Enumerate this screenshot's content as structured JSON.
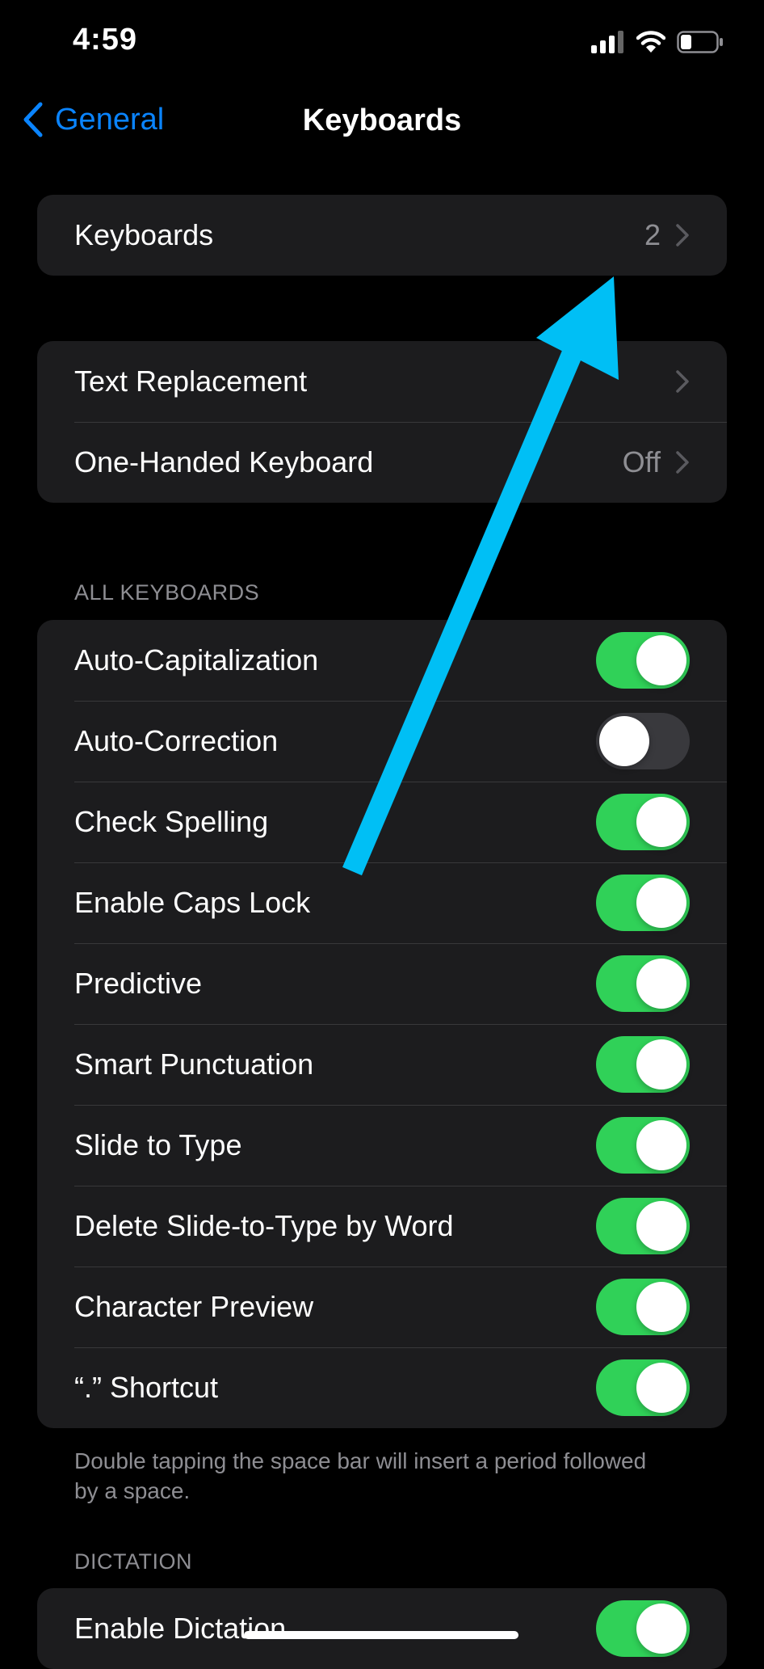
{
  "status_bar": {
    "time": "4:59"
  },
  "nav": {
    "back_label": "General",
    "title": "Keyboards"
  },
  "group1": {
    "keyboards_label": "Keyboards",
    "keyboards_value": "2"
  },
  "group2": {
    "text_replacement_label": "Text Replacement",
    "one_handed_label": "One-Handed Keyboard",
    "one_handed_value": "Off"
  },
  "all_keyboards": {
    "header": "ALL KEYBOARDS",
    "items": [
      {
        "label": "Auto-Capitalization",
        "on": true
      },
      {
        "label": "Auto-Correction",
        "on": false
      },
      {
        "label": "Check Spelling",
        "on": true
      },
      {
        "label": "Enable Caps Lock",
        "on": true
      },
      {
        "label": "Predictive",
        "on": true
      },
      {
        "label": "Smart Punctuation",
        "on": true
      },
      {
        "label": "Slide to Type",
        "on": true
      },
      {
        "label": "Delete Slide-to-Type by Word",
        "on": true
      },
      {
        "label": "Character Preview",
        "on": true
      },
      {
        "label": "“.” Shortcut",
        "on": true
      }
    ],
    "footer": "Double tapping the space bar will insert a period followed by a space."
  },
  "dictation": {
    "header": "DICTATION",
    "items": [
      {
        "label": "Enable Dictation",
        "on": true
      }
    ]
  },
  "colors": {
    "accent": "#0a84ff",
    "toggle_on": "#30d158",
    "toggle_off": "#39393d",
    "arrow": "#00bff5"
  }
}
